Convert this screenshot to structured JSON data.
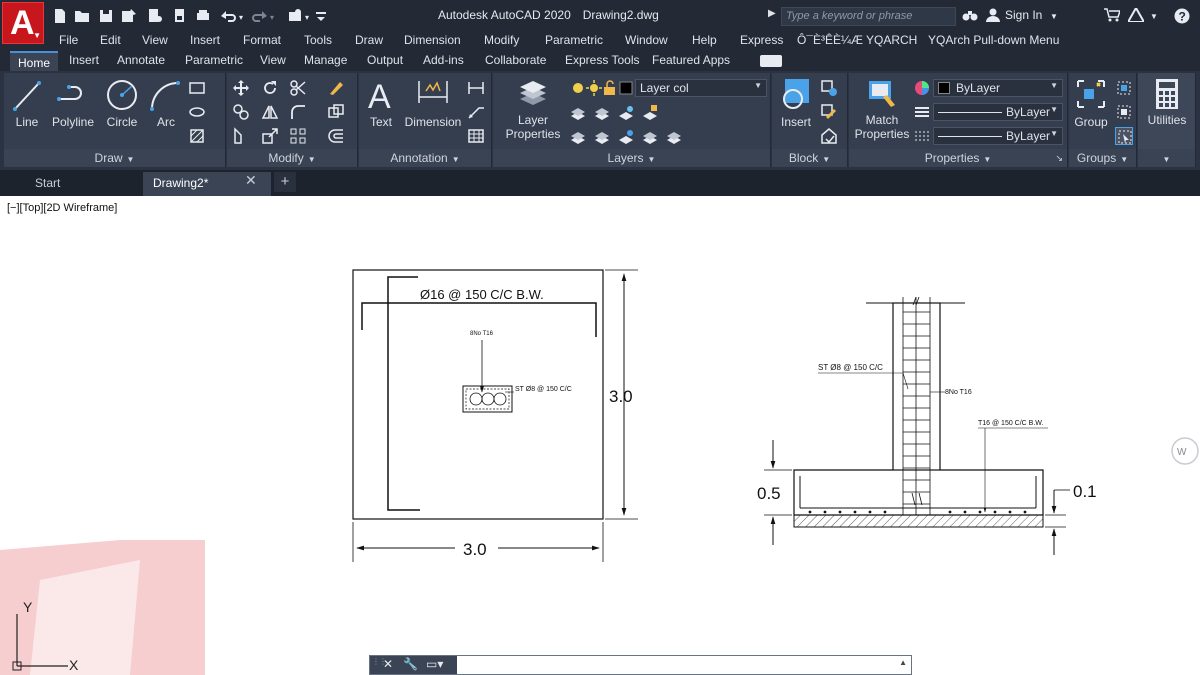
{
  "titlebar": {
    "app_name": "Autodesk AutoCAD 2020",
    "doc_name": "Drawing2.dwg",
    "search_placeholder": "Type a keyword or phrase",
    "sign_in": "Sign In"
  },
  "menu": [
    "File",
    "Edit",
    "View",
    "Insert",
    "Format",
    "Tools",
    "Draw",
    "Dimension",
    "Modify",
    "Parametric",
    "Window",
    "Help",
    "Express",
    "Ô¯È³ÊÈ¼Æ",
    "YQARCH",
    "YQArch Pull-down Menu"
  ],
  "ribbon_tabs": [
    "Home",
    "Insert",
    "Annotate",
    "Parametric",
    "View",
    "Manage",
    "Output",
    "Add-ins",
    "Collaborate",
    "Express Tools",
    "Featured Apps"
  ],
  "panels": {
    "draw": {
      "title": "Draw",
      "buttons": [
        "Line",
        "Polyline",
        "Circle",
        "Arc"
      ]
    },
    "modify": {
      "title": "Modify"
    },
    "annotation": {
      "title": "Annotation",
      "buttons": [
        "Text",
        "Dimension"
      ]
    },
    "layers": {
      "title": "Layers",
      "layer_props_1": "Layer",
      "layer_props_2": "Properties",
      "layer_combo": "Layer col"
    },
    "block": {
      "title": "Block",
      "insert": "Insert"
    },
    "properties": {
      "title": "Properties",
      "match_1": "Match",
      "match_2": "Properties",
      "color_combo": "ByLayer",
      "linetype_combo": "ByLayer",
      "lineweight_combo": "ByLayer"
    },
    "groups": {
      "title": "Groups",
      "group": "Group"
    },
    "utilities": {
      "title": "Utilities"
    }
  },
  "file_tabs": {
    "start": "Start",
    "drawing": "Drawing2*",
    "close": "✕",
    "new": "+"
  },
  "viewport_label": "[−][Top][2D Wireframe]",
  "drawing": {
    "plan": {
      "rebar_note": "Ø16 @ 150 C/C B.W.",
      "column_note": "8No T16",
      "stirrup_note": "ST Ø8 @ 150 C/C",
      "dim_vertical": "3.0",
      "dim_horizontal": "3.0"
    },
    "section": {
      "stirrup_note": "ST Ø8 @ 150 C/C",
      "column_note": "8No T16",
      "bottom_note": "T16 @ 150 C/C B.W.",
      "dim_depth": "0.5",
      "dim_blinding": "0.1"
    }
  },
  "ucs": {
    "x_label": "X",
    "y_label": "Y"
  },
  "cmdline": {
    "placeholder": ""
  }
}
